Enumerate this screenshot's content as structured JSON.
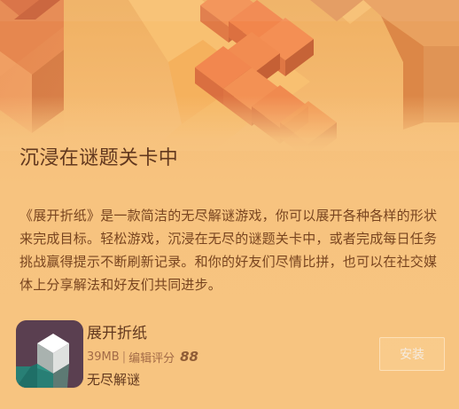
{
  "section": {
    "title": "沉浸在谜题关卡中"
  },
  "description": {
    "text": "《展开折纸》是一款简洁的无尽解谜游戏，你可以展开各种各样的形状来完成目标。轻松游戏，沉浸在无尽的谜题关卡中，或者完成每日任务挑战赢得提示不断刷新记录。和你的好友们尽情比拼，也可以在社交媒体上分享解法和好友们共同进步。"
  },
  "app": {
    "name": "展开折纸",
    "size": "39MB",
    "divider": "|",
    "rating_label": "编辑评分",
    "rating_value": "88",
    "genre": "无尽解谜",
    "install_label": "安装"
  },
  "colors": {
    "background": "#f7c37f",
    "title_text": "#62381e",
    "body_text": "#78441f",
    "meta_text": "#a36b47",
    "icon_background": "#5a3f50",
    "hero_block_top": "#f28f5a",
    "hero_block_side": "#c86b3e"
  }
}
